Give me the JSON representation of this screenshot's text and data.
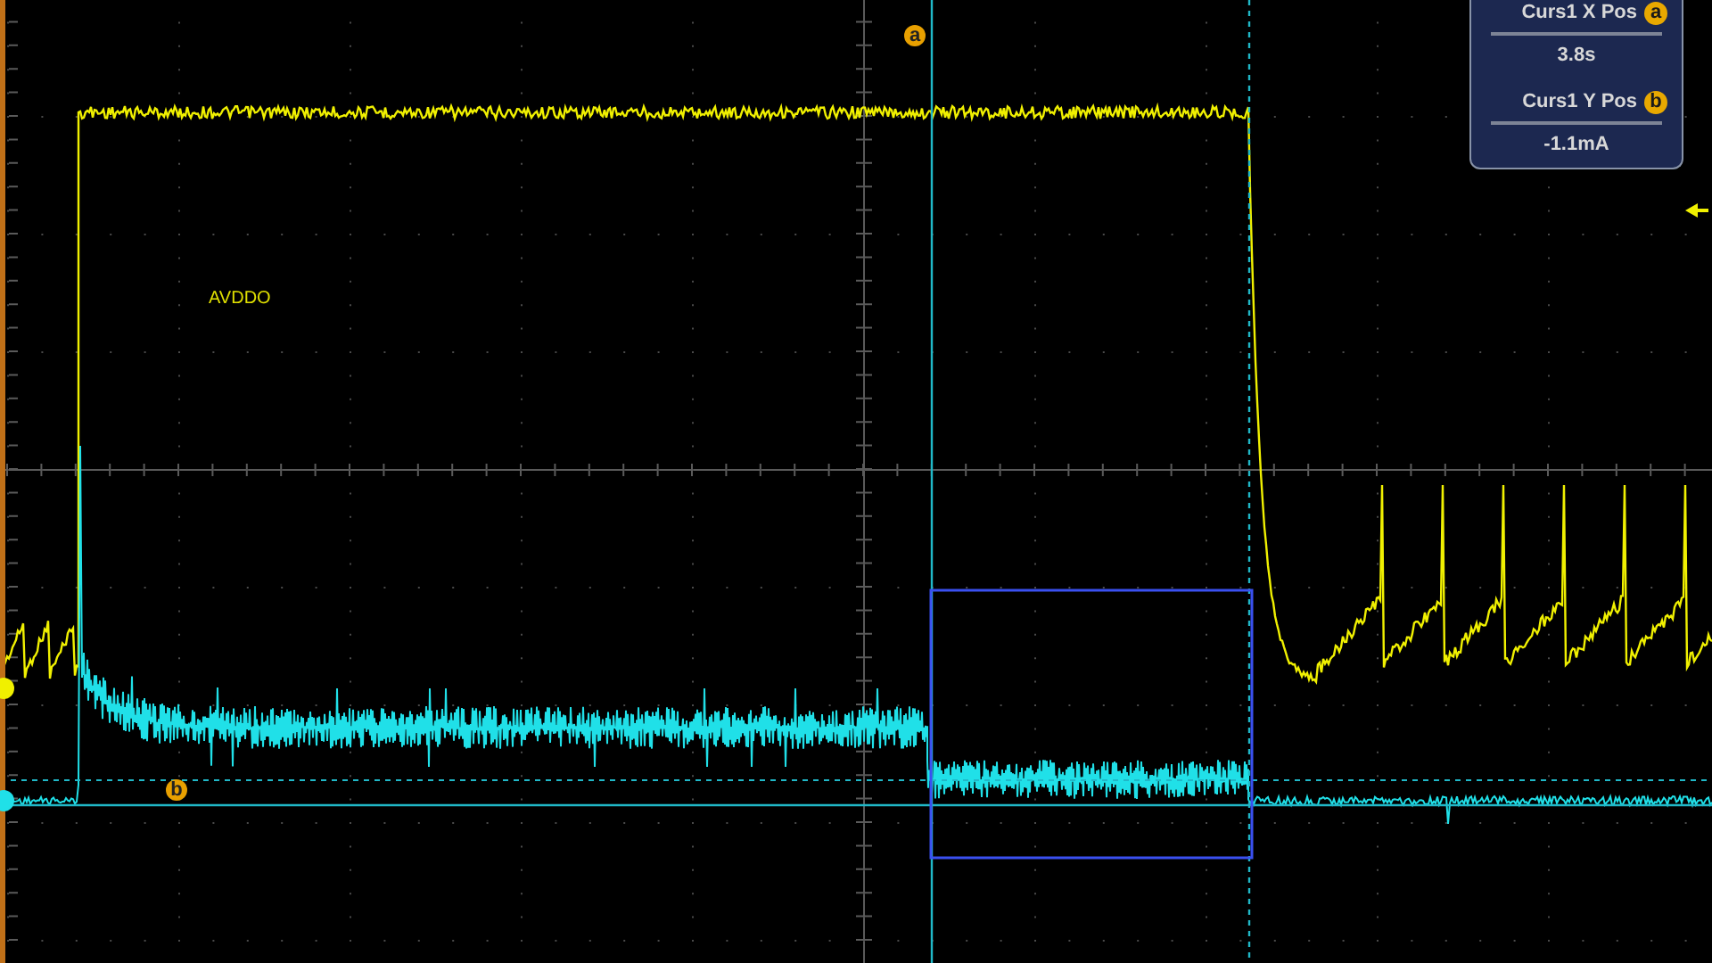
{
  "channel_label": "AVDDO",
  "cursor_markers": [
    {
      "label": "a"
    },
    {
      "label": "b"
    }
  ],
  "readout": [
    {
      "label": "Curs1 X Pos",
      "marker": "a",
      "value": "3.8s"
    },
    {
      "label": "Curs1 Y Pos",
      "marker": "b",
      "value": "-1.1mA"
    }
  ]
}
